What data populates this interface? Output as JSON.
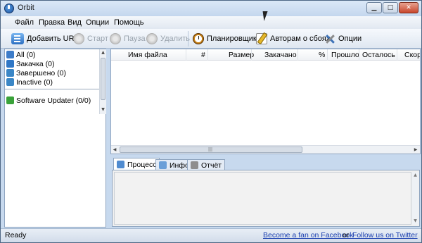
{
  "window": {
    "title": "Orbit"
  },
  "menu": [
    "Файл",
    "Правка",
    "Вид",
    "Опции",
    "Помощь"
  ],
  "toolbar": {
    "add_url": "Добавить URL",
    "start": "Старт",
    "pause": "Пауза",
    "delete": "Удалить",
    "scheduler": "Планировщик",
    "report": "Авторам о сбоях",
    "options": "Опции"
  },
  "categories": [
    {
      "label": "All (0)",
      "color": "#3d7cc9"
    },
    {
      "label": "Закачка (0)",
      "color": "#2f77c6"
    },
    {
      "label": "Завершено (0)",
      "color": "#3a86c6"
    },
    {
      "label": "Inactive (0)",
      "color": "#3a86c6"
    }
  ],
  "updater": {
    "label": "Software Updater (0/0)",
    "color": "#3aa23a"
  },
  "table": {
    "columns": [
      "Имя файла",
      "#",
      "Размер",
      "Закачано",
      "%",
      "Прошло",
      "Осталось",
      "Скор"
    ]
  },
  "tabs": [
    "Процесс",
    "Инфо",
    "Отчёт"
  ],
  "status": {
    "text": "Ready",
    "facebook": "Become a fan on Facebook",
    "or": "or",
    "twitter": "Follow us on Twitter"
  }
}
